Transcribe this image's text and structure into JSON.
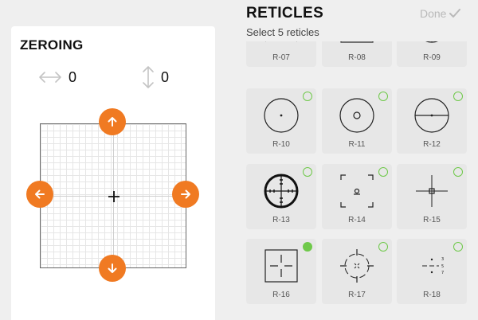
{
  "zeroing": {
    "title": "ZEROING",
    "horizontal_value": "0",
    "vertical_value": "0",
    "icons": [
      "horizontal-arrows-icon",
      "vertical-arrows-icon",
      "arrow-up-icon",
      "arrow-down-icon",
      "arrow-left-icon",
      "arrow-right-icon"
    ],
    "accent_color": "#f07a22"
  },
  "reticles": {
    "title": "RETICLES",
    "subtitle": "Select 5 reticles",
    "done_label": "Done",
    "done_icon": "check-icon",
    "select_color": "#6fc94a",
    "items": [
      {
        "label": "R-07",
        "selectable": false,
        "selected": false
      },
      {
        "label": "R-08",
        "selectable": false,
        "selected": false
      },
      {
        "label": "R-09",
        "selectable": false,
        "selected": false
      },
      {
        "label": "R-10",
        "selectable": true,
        "selected": false
      },
      {
        "label": "R-11",
        "selectable": true,
        "selected": false
      },
      {
        "label": "R-12",
        "selectable": true,
        "selected": false
      },
      {
        "label": "R-13",
        "selectable": true,
        "selected": false
      },
      {
        "label": "R-14",
        "selectable": true,
        "selected": false
      },
      {
        "label": "R-15",
        "selectable": true,
        "selected": false
      },
      {
        "label": "R-16",
        "selectable": true,
        "selected": true
      },
      {
        "label": "R-17",
        "selectable": true,
        "selected": false
      },
      {
        "label": "R-18",
        "selectable": true,
        "selected": false
      }
    ]
  }
}
